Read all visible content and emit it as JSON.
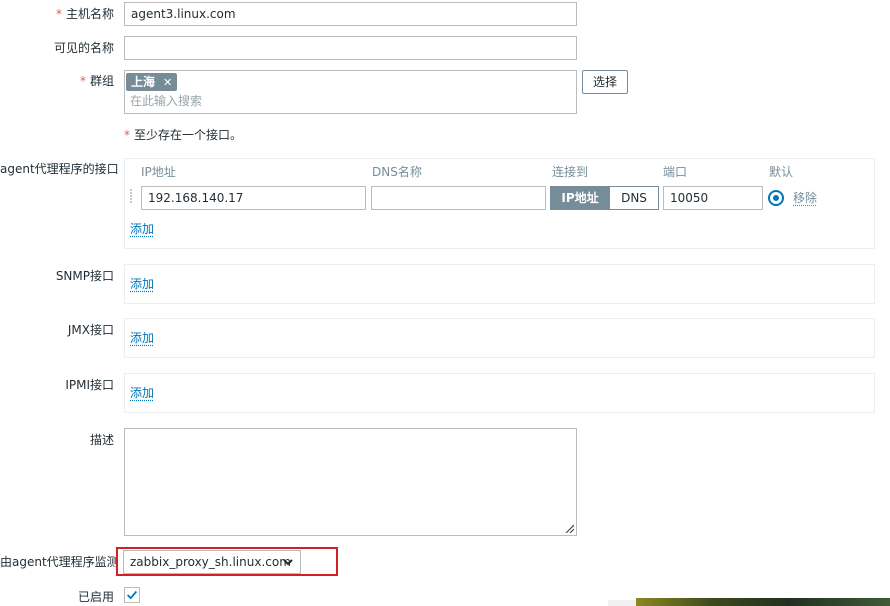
{
  "form": {
    "host_name": {
      "label": "主机名称",
      "required_mark": "*",
      "value": "agent3.linux.com"
    },
    "visible_name": {
      "label": "可见的名称",
      "value": ""
    },
    "groups": {
      "label": "群组",
      "required_mark": "*",
      "chips": [
        "上海"
      ],
      "placeholder": "在此输入搜索",
      "select_button": "选择"
    },
    "interface_note": {
      "required_mark": "*",
      "text": "至少存在一个接口。"
    },
    "agent_interfaces": {
      "label": "agent代理程序的接口",
      "columns": {
        "ip": "IP地址",
        "dns": "DNS名称",
        "connect_to": "连接到",
        "port": "端口",
        "default": "默认"
      },
      "row": {
        "ip": "192.168.140.17",
        "dns": "",
        "connect_options": [
          "IP地址",
          "DNS"
        ],
        "connect_selected": "IP地址",
        "port": "10050",
        "remove": "移除"
      },
      "add": "添加"
    },
    "snmp_interfaces": {
      "label": "SNMP接口",
      "add": "添加"
    },
    "jmx_interfaces": {
      "label": "JMX接口",
      "add": "添加"
    },
    "ipmi_interfaces": {
      "label": "IPMI接口",
      "add": "添加"
    },
    "description": {
      "label": "描述",
      "value": ""
    },
    "monitored_by_proxy": {
      "label": "由agent代理程序监测",
      "value": "zabbix_proxy_sh.linux.com"
    },
    "enabled": {
      "label": "已启用",
      "checked": true
    }
  },
  "colors": {
    "accent": "#0275b8",
    "required": "#e45959",
    "highlight": "#d02028",
    "chip": "#768d99"
  }
}
